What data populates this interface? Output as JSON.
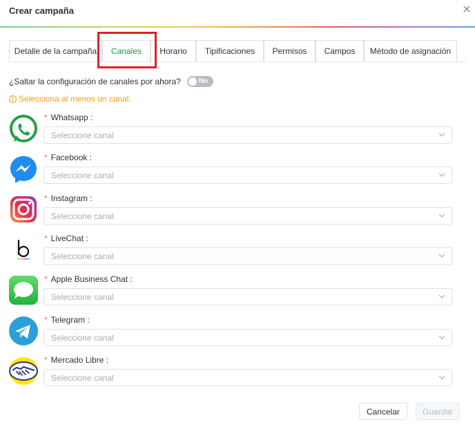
{
  "dialog": {
    "title": "Crear campaña",
    "close_icon": "close-icon"
  },
  "tabs": [
    {
      "label": "Detalle de la campaña",
      "active": false
    },
    {
      "label": "Canales",
      "active": true
    },
    {
      "label": "Horario",
      "active": false
    },
    {
      "label": "Tipificaciones",
      "active": false
    },
    {
      "label": "Permisos",
      "active": false
    },
    {
      "label": "Campos",
      "active": false
    },
    {
      "label": "Método de asignación",
      "active": false
    }
  ],
  "skip": {
    "label": "¿Saltar la configuración de canales por ahora?",
    "toggle_text": "No"
  },
  "warning": {
    "icon": "info-circle-icon",
    "text": "Selecciona al menos un canal."
  },
  "channels": [
    {
      "label": "Whatsapp",
      "placeholder": "Seleccione canal",
      "icon": "whatsapp-icon"
    },
    {
      "label": "Facebook",
      "placeholder": "Seleccione canal",
      "icon": "messenger-icon"
    },
    {
      "label": "Instagram",
      "placeholder": "Seleccione canal",
      "icon": "instagram-icon"
    },
    {
      "label": "LiveChat",
      "placeholder": "Seleccione canal",
      "icon": "livechat-icon"
    },
    {
      "label": "Apple Business Chat",
      "placeholder": "Seleccione canal",
      "icon": "apple-messages-icon"
    },
    {
      "label": "Telegram",
      "placeholder": "Seleccione canal",
      "icon": "telegram-icon"
    },
    {
      "label": "Mercado Libre",
      "placeholder": "Seleccione canal",
      "icon": "mercadolibre-icon"
    }
  ],
  "footer": {
    "cancel_label": "Cancelar",
    "save_label": "Guardar"
  },
  "colors": {
    "accent": "#19a139",
    "warning": "#f39c12",
    "required": "#f56c6c",
    "highlight": "#e0202a"
  }
}
